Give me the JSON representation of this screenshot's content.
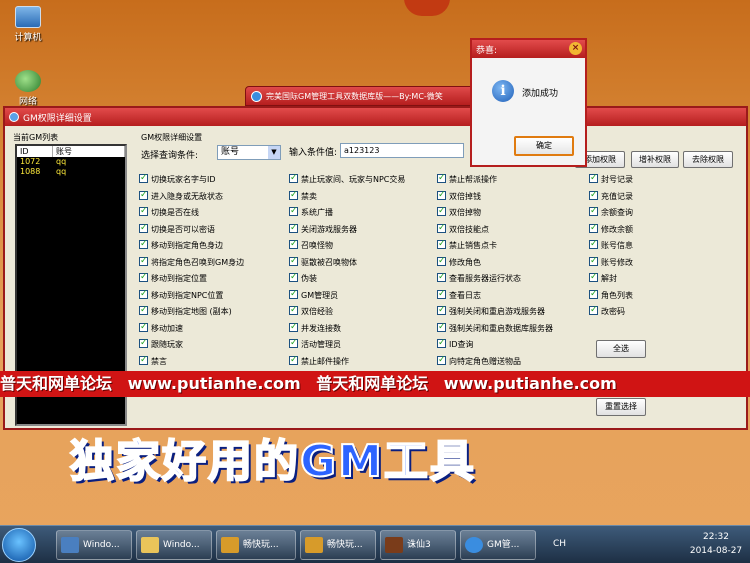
{
  "desktop": {
    "icons": [
      {
        "label": "计算机"
      },
      {
        "label": "网络"
      }
    ]
  },
  "back_window": {
    "title": "完美国际GM管理工具双数据库版——By:MC-微笑"
  },
  "main_window": {
    "title": "GM权限详细设置",
    "gm_list": {
      "group_label": "当前GM列表",
      "columns": [
        "ID",
        "账号"
      ],
      "rows": [
        {
          "id": "1072",
          "account": "qq"
        },
        {
          "id": "1088",
          "account": "qq"
        }
      ]
    },
    "permissions": {
      "group_label": "GM权限详细设置",
      "query_label": "选择查询条件:",
      "query_value": "账号",
      "condition_label": "输入条件值:",
      "condition_value": "a123123",
      "buttons": {
        "add": "添加权限",
        "supplement": "增补权限",
        "remove": "去除权限",
        "select_all": "全选",
        "reset": "重置选择"
      },
      "columns": [
        [
          "切换玩家名字与ID",
          "进入隐身或无敌状态",
          "切换是否在线",
          "切换是否可以密语",
          "移动到指定角色身边",
          "将指定角色召唤到GM身边",
          "移动到指定位置",
          "移动到指定NPC位置",
          "移动到指定地图 (副本)",
          "移动加速",
          "跟随玩家",
          "禁言"
        ],
        [
          "禁止玩家间、玩家与NPC交易",
          "禁卖",
          "系统广播",
          "关闭游戏服务器",
          "召唤怪物",
          "驱散被召唤物体",
          "伪装",
          "GM管理员",
          "双倍经验",
          "并发连接数",
          "活动管理员",
          "禁止邮件操作"
        ],
        [
          "禁止帮派操作",
          "双倍掉钱",
          "双倍掉物",
          "双倍技能点",
          "禁止销售点卡",
          "修改角色",
          "查看服务器运行状态",
          "查看日志",
          "强制关闭和重启游戏服务器",
          "强制关闭和重启数据库服务器",
          "ID查询",
          "向特定角色赠送物品"
        ],
        [
          "封号记录",
          "充值记录",
          "余额查询",
          "修改余额",
          "账号信息",
          "账号修改",
          "解封",
          "角色列表",
          "改密码"
        ]
      ]
    }
  },
  "dialog": {
    "title": "恭喜:",
    "message": "添加成功",
    "ok_label": "确定"
  },
  "banner": {
    "segments": [
      "普天和网单论坛",
      "www.putianhe.com",
      "普天和网单论坛",
      "www.putianhe.com"
    ]
  },
  "caption": "独家好用的GM工具",
  "taskbar": {
    "items": [
      "Windo...",
      "Windo...",
      "畅快玩...",
      "畅快玩...",
      "诛仙3",
      "GM管..."
    ],
    "lang": "CH",
    "time": "22:32",
    "date": "2014-08-27"
  },
  "colors": {
    "title_red": "#b51e1e",
    "banner_red": "#d01414",
    "caption_blue": "#2d64ff",
    "list_text_yellow": "#ffeb3b"
  }
}
